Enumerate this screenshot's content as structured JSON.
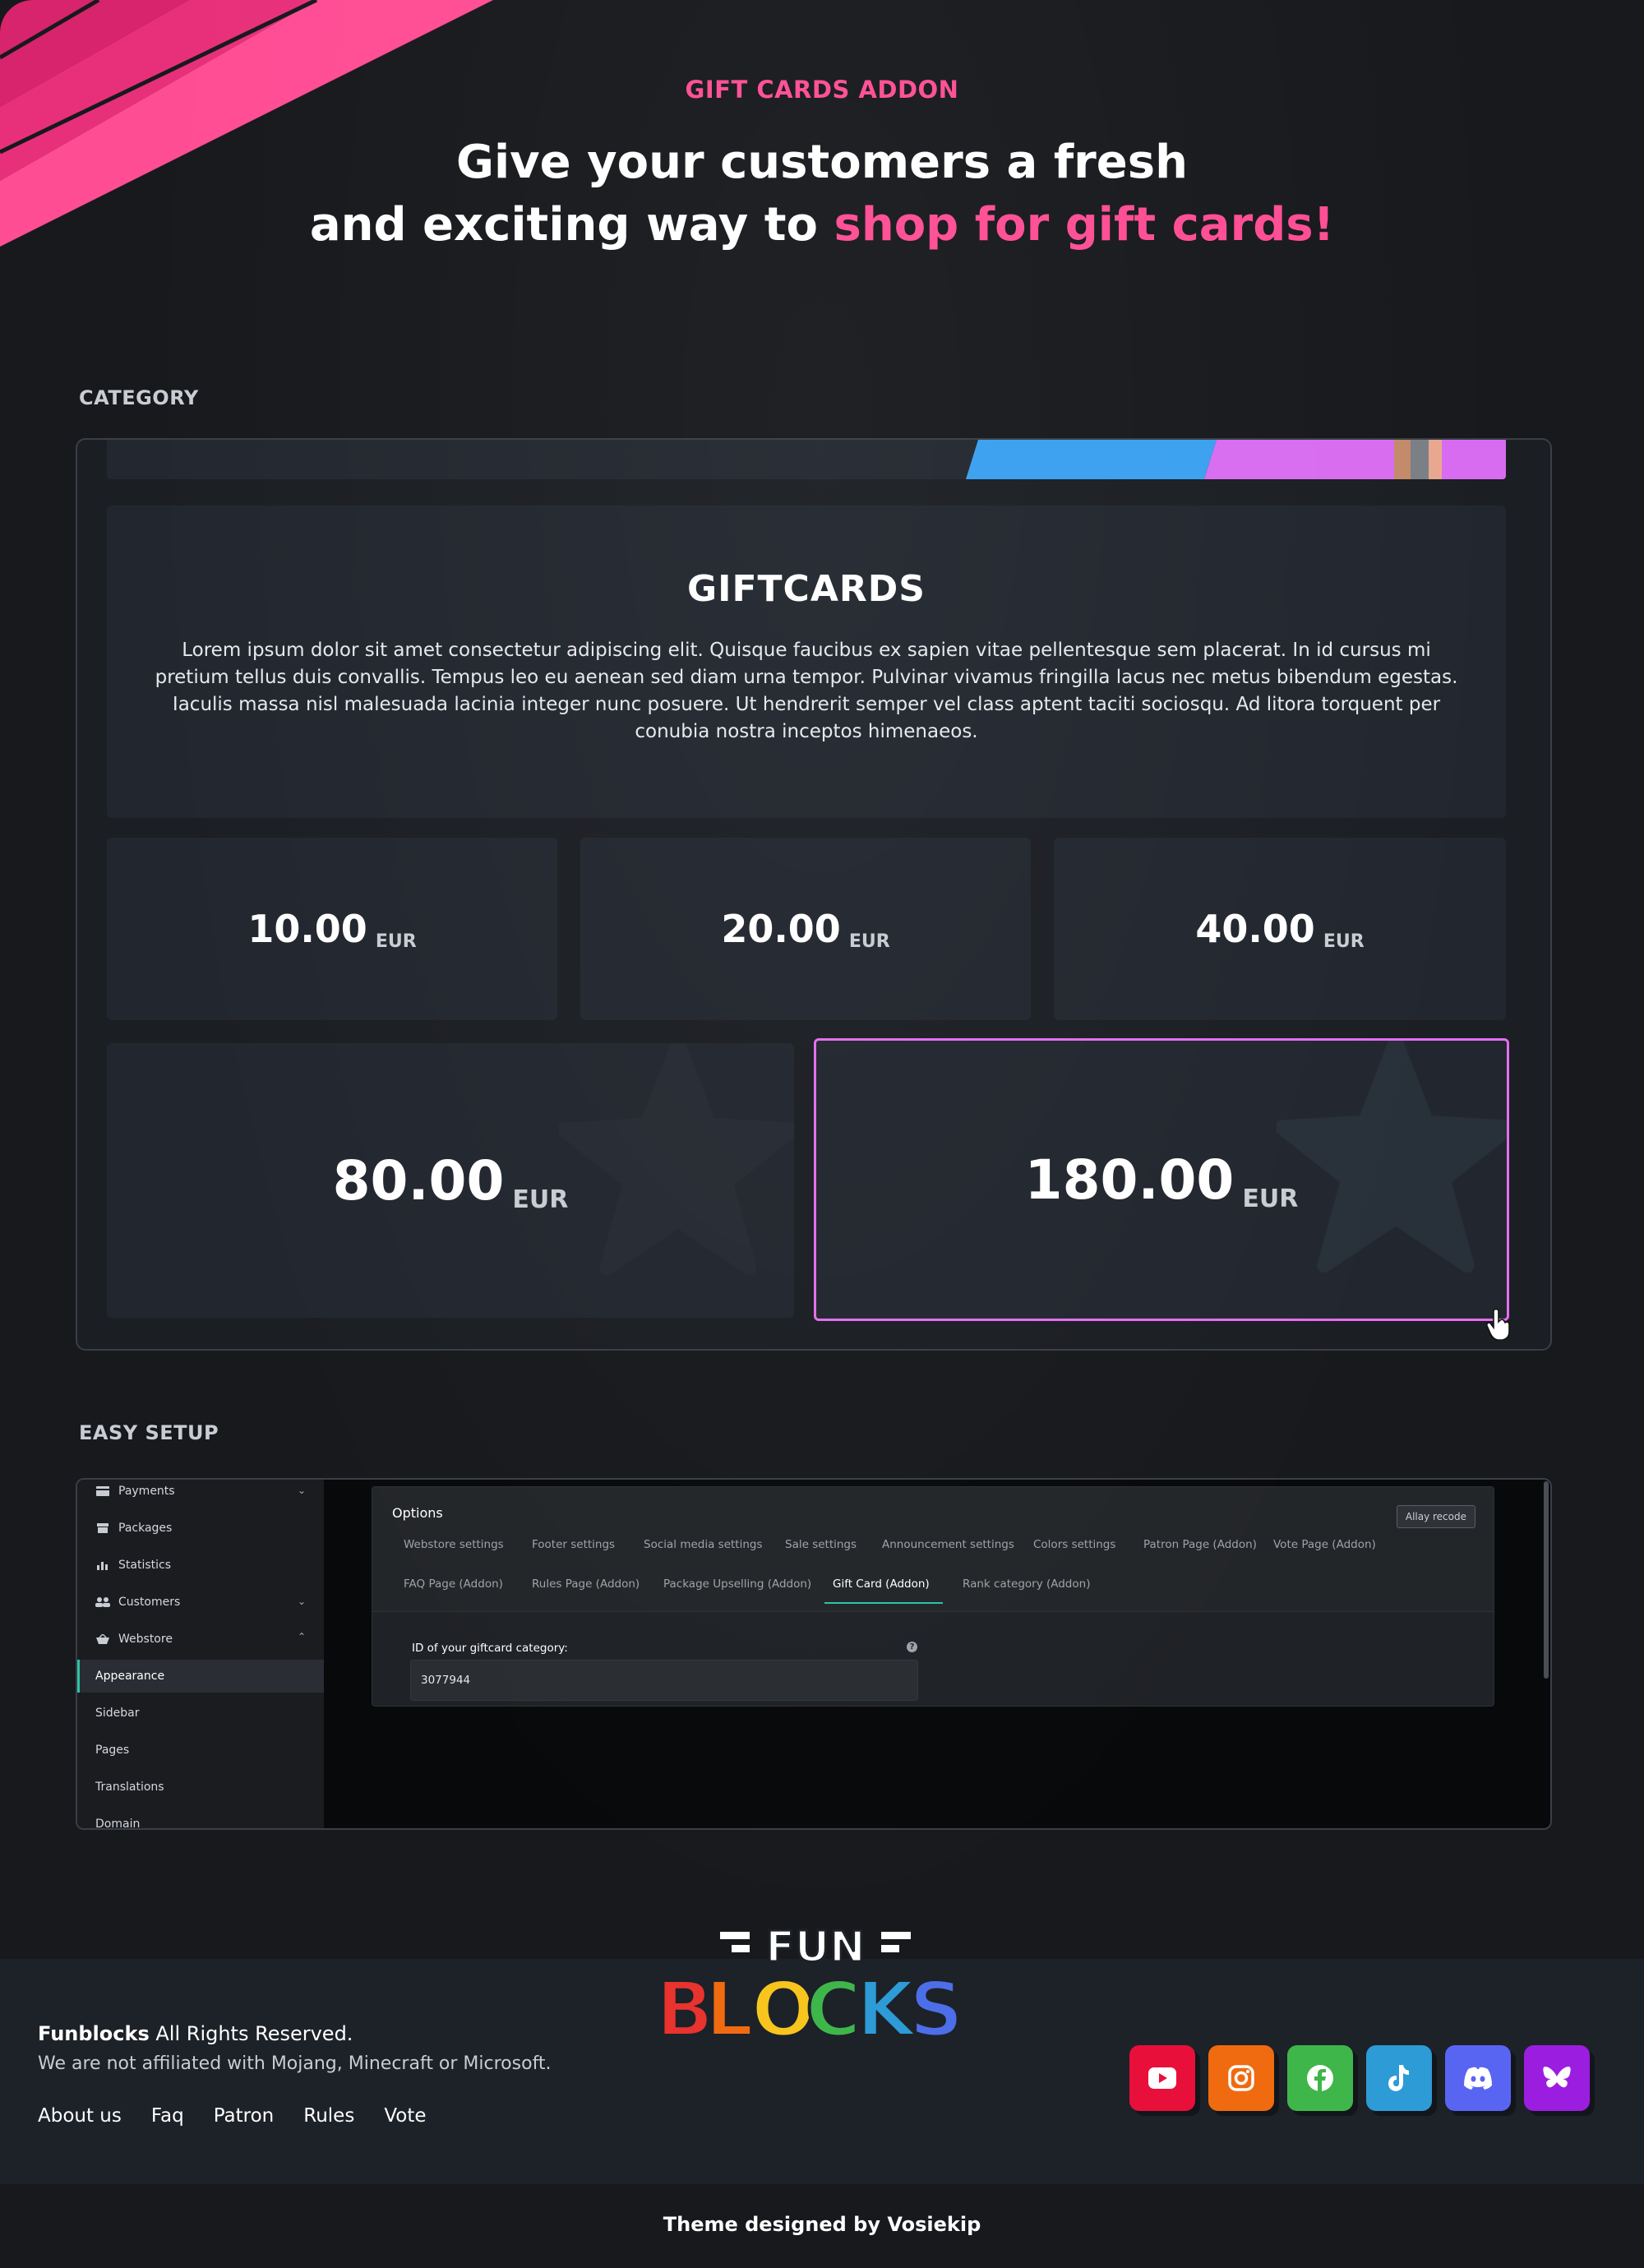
{
  "hero": {
    "eyebrow": "GIFT CARDS ADDON",
    "title_line1": "Give your customers a fresh",
    "title_line2_plain": "and exciting way to ",
    "title_line2_accent": "shop for gift cards!"
  },
  "category_section": {
    "label": "CATEGORY",
    "panel_title": "GIFTCARDS",
    "description": "Lorem ipsum dolor sit amet consectetur adipiscing elit. Quisque faucibus ex sapien vitae pellentesque sem placerat. In id cursus mi pretium tellus duis convallis. Tempus leo eu aenean sed diam urna tempor. Pulvinar vivamus fringilla lacus nec metus bibendum egestas. Iaculis massa nisl malesuada lacinia integer nunc posuere. Ut hendrerit semper vel class aptent taciti sociosqu. Ad litora torquent per conubia nostra inceptos himenaeos.",
    "cards": [
      {
        "amount": "10.00",
        "currency": "EUR"
      },
      {
        "amount": "20.00",
        "currency": "EUR"
      },
      {
        "amount": "40.00",
        "currency": "EUR"
      },
      {
        "amount": "80.00",
        "currency": "EUR"
      },
      {
        "amount": "180.00",
        "currency": "EUR"
      }
    ]
  },
  "setup_section": {
    "label": "EASY SETUP",
    "sidebar": [
      {
        "label": "Payments",
        "icon": "card-icon"
      },
      {
        "label": "Packages",
        "icon": "box-icon"
      },
      {
        "label": "Statistics",
        "icon": "bar-chart-icon"
      },
      {
        "label": "Customers",
        "icon": "users-icon"
      },
      {
        "label": "Webstore",
        "icon": "basket-icon"
      },
      {
        "label": "Appearance"
      },
      {
        "label": "Sidebar"
      },
      {
        "label": "Pages"
      },
      {
        "label": "Translations"
      },
      {
        "label": "Domain"
      }
    ],
    "options": {
      "title": "Options",
      "recode_button": "Allay recode",
      "tabs_row1": [
        "Webstore settings",
        "Footer settings",
        "Social media settings",
        "Sale settings",
        "Announcement settings",
        "Colors settings",
        "Patron Page (Addon)",
        "Vote Page (Addon)"
      ],
      "tabs_row2": [
        "FAQ Page (Addon)",
        "Rules Page (Addon)",
        "Package Upselling (Addon)",
        "Gift Card (Addon)",
        "Rank category (Addon)"
      ],
      "active_tab": "Gift Card (Addon)",
      "field_label": "ID of your giftcard category:",
      "field_value": "3077944"
    }
  },
  "footer": {
    "logo_top": "FUN",
    "logo_bottom": "BLOCKS",
    "brand": "Funblocks",
    "rights": " All Rights Reserved.",
    "disclaimer": "We are not affiliated with Mojang, Minecraft or Microsoft.",
    "links": [
      "About us",
      "Faq",
      "Patron",
      "Rules",
      "Vote"
    ],
    "socials": [
      {
        "name": "youtube-icon",
        "color": "#e8103a"
      },
      {
        "name": "instagram-icon",
        "color": "#f06a10"
      },
      {
        "name": "facebook-icon",
        "color": "#3fb64a"
      },
      {
        "name": "tiktok-icon",
        "color": "#2d9bd6"
      },
      {
        "name": "discord-icon",
        "color": "#5865f2"
      },
      {
        "name": "bluesky-icon",
        "color": "#9b1ee0"
      }
    ],
    "credit": "Theme designed by Vosiekip"
  },
  "colors": {
    "accent": "#ff4d94",
    "selected_border": "#e46ef0",
    "active_tab": "#2bc3a8"
  }
}
